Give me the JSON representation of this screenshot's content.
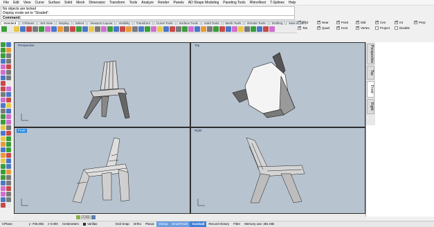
{
  "menu": [
    "File",
    "Edit",
    "View",
    "Curve",
    "Surface",
    "Solid",
    "Mesh",
    "Dimension",
    "Transform",
    "Tools",
    "Analyze",
    "Render",
    "Panels",
    "AD Shape Modeling",
    "Paneling Tools",
    "RhinoNest",
    "T-Splines",
    "Help"
  ],
  "command_history": [
    "No objects are locked",
    "Display mode set to \"Shaded\"."
  ],
  "command_prompt": "Command:",
  "toolbar_tabs": [
    {
      "label": "Standard",
      "active": true
    },
    {
      "label": "CPlanes",
      "active": false
    },
    {
      "label": "Set View",
      "active": false
    },
    {
      "label": "Display",
      "active": false
    },
    {
      "label": "Select",
      "active": false
    },
    {
      "label": "Viewport Layout",
      "active": false
    },
    {
      "label": "Visibility",
      "active": false
    },
    {
      "label": "Transform",
      "active": false
    },
    {
      "label": "Curve Tools",
      "active": false
    },
    {
      "label": "Surface Tools",
      "active": false
    },
    {
      "label": "Solid Tools",
      "active": false
    },
    {
      "label": "Mesh Tools",
      "active": false
    },
    {
      "label": "Render Tools",
      "active": false
    },
    {
      "label": "Drafting",
      "active": false
    },
    {
      "label": "New in V5",
      "active": false
    }
  ],
  "osnaps": [
    {
      "label": "End",
      "checked": true
    },
    {
      "label": "Near",
      "checked": true
    },
    {
      "label": "Point",
      "checked": true
    },
    {
      "label": "Mid",
      "checked": true
    },
    {
      "label": "Cen",
      "checked": true
    },
    {
      "label": "Int",
      "checked": true
    },
    {
      "label": "Perp",
      "checked": true
    },
    {
      "label": "Tan",
      "checked": true
    },
    {
      "label": "Quad",
      "checked": true
    },
    {
      "label": "Knot",
      "checked": true
    },
    {
      "label": "Vertex",
      "checked": true
    },
    {
      "label": "Project",
      "checked": false
    },
    {
      "label": "Disable",
      "checked": false
    }
  ],
  "viewports": [
    {
      "label": "Perspective",
      "active": false
    },
    {
      "label": "Top",
      "active": false
    },
    {
      "label": "Front",
      "active": true
    },
    {
      "label": "Right",
      "active": false
    }
  ],
  "side_tabs": [
    {
      "label": "Perspective",
      "active": false
    },
    {
      "label": "Top",
      "active": false
    },
    {
      "label": "Front",
      "active": true
    },
    {
      "label": "Right",
      "active": false
    }
  ],
  "nav": {
    "value": "2.000"
  },
  "status": {
    "cplane": "CPlane",
    "x": "x -708.066",
    "y": "y -706.065",
    "z": "z 0.000",
    "units": "Centimeters",
    "layer": "Varillas",
    "grid_snap": "Grid Snap",
    "ortho": "Ortho",
    "planar": "Planar",
    "osnap": "Osnap",
    "smarttrack": "SmartTrack",
    "gumball": "Gumball",
    "record_history": "Record History",
    "filter": "Filter",
    "memory": "Memory use: 381 MB"
  },
  "colors": {
    "viewport_bg": "#b7c3cf",
    "active_label": "#2a8ce6",
    "osnap_on": "#6b9fe0"
  }
}
